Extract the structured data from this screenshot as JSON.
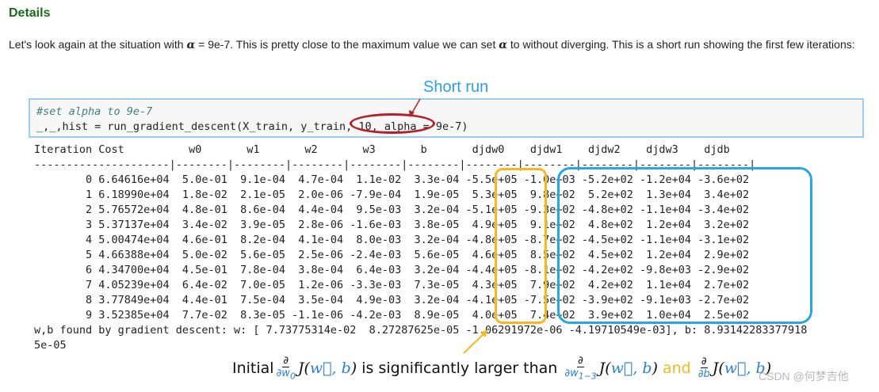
{
  "heading": "Details",
  "intro": {
    "part1": "Let's look again at the situation with ",
    "alpha_sym": "α",
    "part2": " = 9e-7. This is pretty close to the maximum value we can set ",
    "part3": " to without diverging. This is a short run showing the first few iterations:"
  },
  "annotation_short_run": "Short run",
  "code": {
    "comment": "#set alpha to 9e-7",
    "line": "_,_,hist = run_gradient_descent(X_train, y_train, 10, alpha = 9e-7)"
  },
  "output": {
    "header": "Iteration Cost          w0       w1       w2       w3       b       djdw0    djdw1    djdw2    djdw3    djdb",
    "separator": "---------------------|--------|--------|--------|--------|--------|--------|--------|--------|--------|--------|",
    "rows": [
      "        0 6.64616e+04  5.0e-01  9.1e-04  4.7e-04  1.1e-02  3.3e-04 -5.5e+05 -1.0e+03 -5.2e+02 -1.2e+04 -3.6e+02",
      "        1 6.18990e+04  1.8e-02  2.1e-05  2.0e-06 -7.9e-04  1.9e-05  5.3e+05  9.8e+02  5.2e+02  1.3e+04  3.4e+02",
      "        2 5.76572e+04  4.8e-01  8.6e-04  4.4e-04  9.5e-03  3.2e-04 -5.1e+05 -9.3e+02 -4.8e+02 -1.1e+04 -3.4e+02",
      "        3 5.37137e+04  3.4e-02  3.9e-05  2.8e-06 -1.6e-03  3.8e-05  4.9e+05  9.1e+02  4.8e+02  1.2e+04  3.2e+02",
      "        4 5.00474e+04  4.6e-01  8.2e-04  4.1e-04  8.0e-03  3.2e-04 -4.8e+05 -8.7e+02 -4.5e+02 -1.1e+04 -3.1e+02",
      "        5 4.66388e+04  5.0e-02  5.6e-05  2.5e-06 -2.4e-03  5.6e-05  4.6e+05  8.5e+02  4.5e+02  1.2e+04  2.9e+02",
      "        6 4.34700e+04  4.5e-01  7.8e-04  3.8e-04  6.4e-03  3.2e-04 -4.4e+05 -8.1e+02 -4.2e+02 -9.8e+03 -2.9e+02",
      "        7 4.05239e+04  6.4e-02  7.0e-05  1.2e-06 -3.3e-03  7.3e-05  4.3e+05  7.9e+02  4.2e+02  1.1e+04  2.7e+02",
      "        8 3.77849e+04  4.4e-01  7.5e-04  3.5e-04  4.9e-03  3.2e-04 -4.1e+05 -7.5e+02 -3.9e+02 -9.1e+03 -2.7e+02",
      "        9 3.52385e+04  7.7e-02  8.3e-05 -1.1e-06 -4.2e-03  8.9e-05  4.0e+05  7.4e+02  3.9e+02  1.0e+04  2.5e+02"
    ],
    "final_line1": "w,b found by gradient descent: w: [ 7.73775314e-02  8.27287625e-05 -1.06291972e-06 -4.19710549e-03], b: 8.93142283377918",
    "final_line2": "5e-05"
  },
  "bottom_annotation": {
    "initial": "Initial",
    "partial": "∂",
    "w0": "∂w",
    "w0_sub": "0",
    "J": "J(",
    "vec_w": "w⃗",
    "comma_b": ", b",
    "close": ")",
    "larger": " is significantly larger than ",
    "w13": "∂w",
    "w13_sub": "1−3",
    "and": " and ",
    "db": "∂b"
  },
  "watermark": "CSDN @何梦吉他",
  "colors": {
    "heading": "#1a6b1a",
    "blue": "#29a6df",
    "orange": "#f5b820",
    "red": "#b2202a"
  }
}
